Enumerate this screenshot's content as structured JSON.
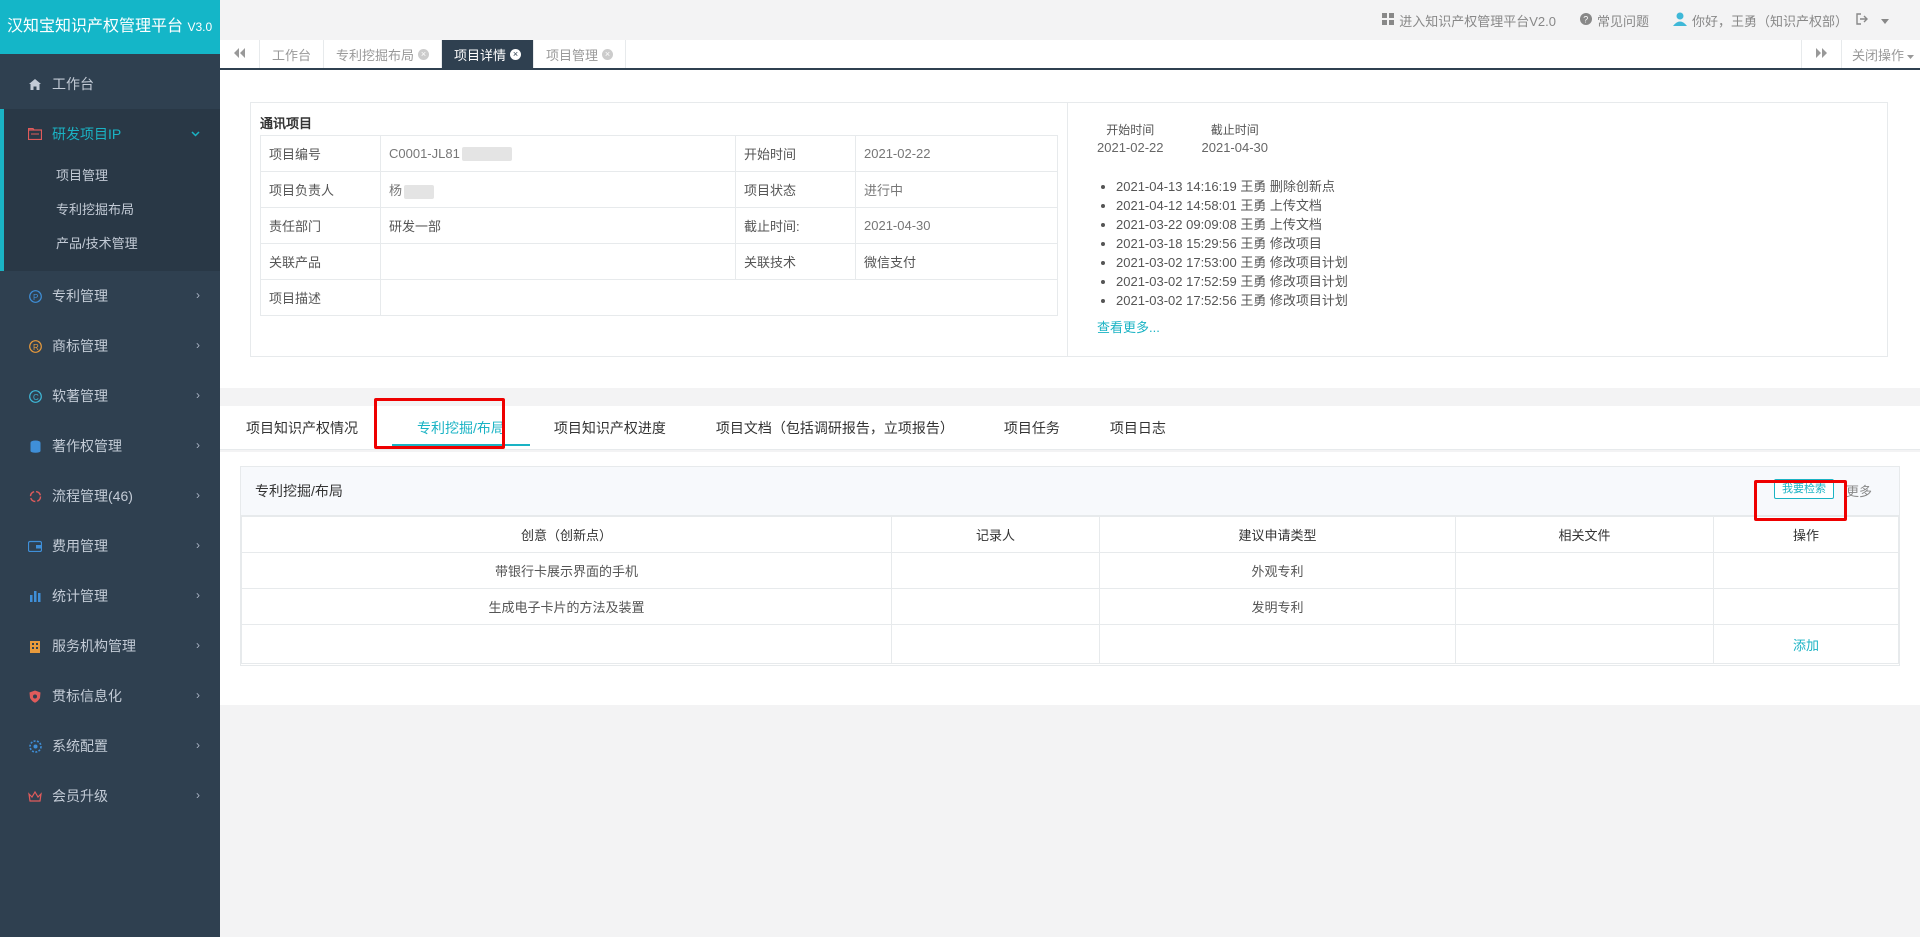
{
  "brand": {
    "title": "汉知宝知识产权管理平台",
    "version": "V3.0"
  },
  "sidebar": {
    "items": [
      {
        "label": "工作台"
      },
      {
        "label": "研发项目IP",
        "children": [
          "项目管理",
          "专利挖掘布局",
          "产品/技术管理"
        ]
      },
      {
        "label": "专利管理"
      },
      {
        "label": "商标管理"
      },
      {
        "label": "软著管理"
      },
      {
        "label": "著作权管理"
      },
      {
        "label": "流程管理(46)"
      },
      {
        "label": "费用管理"
      },
      {
        "label": "统计管理"
      },
      {
        "label": "服务机构管理"
      },
      {
        "label": "贯标信息化"
      },
      {
        "label": "系统配置"
      },
      {
        "label": "会员升级"
      }
    ]
  },
  "topbar": {
    "enter_v2": "进入知识产权管理平台V2.0",
    "faq": "常见问题",
    "user": "你好，王勇（知识产权部）"
  },
  "page_tabs": {
    "tabs": [
      "工作台",
      "专利挖掘布局",
      "项目详情",
      "项目管理"
    ],
    "active": "项目详情",
    "close_ops": "关闭操作"
  },
  "project": {
    "title": "通讯项目",
    "rows": [
      {
        "l1": "项目编号",
        "v1": "C0001-JL81",
        "l2": "开始时间",
        "v2": "2021-02-22"
      },
      {
        "l1": "项目负责人",
        "v1": "杨",
        "l2": "项目状态",
        "v2": "进行中"
      },
      {
        "l1": "责任部门",
        "v1": "研发一部",
        "l2": "截止时间:",
        "v2": "2021-04-30"
      },
      {
        "l1": "关联产品",
        "v1": "",
        "l2": "关联技术",
        "v2": "微信支付"
      }
    ],
    "desc_label": "项目描述",
    "desc_value": ""
  },
  "timeline": {
    "start_label": "开始时间",
    "start_value": "2021-02-22",
    "end_label": "截止时间",
    "end_value": "2021-04-30",
    "logs": [
      "2021-04-13 14:16:19 王勇 删除创新点",
      "2021-04-12 14:58:01 王勇 上传文档",
      "2021-03-22 09:09:08 王勇 上传文档",
      "2021-03-18 15:29:56 王勇 修改项目",
      "2021-03-02 17:53:00 王勇 修改项目计划",
      "2021-03-02 17:52:59 王勇 修改项目计划",
      "2021-03-02 17:52:56 王勇 修改项目计划"
    ],
    "more": "查看更多..."
  },
  "sub_tabs": {
    "tabs": [
      "项目知识产权情况",
      "专利挖掘/布局",
      "项目知识产权进度",
      "项目文档（包括调研报告，立项报告）",
      "项目任务",
      "项目日志"
    ],
    "active": "专利挖掘/布局"
  },
  "mining": {
    "title": "专利挖掘/布局",
    "search_button": "我要检索",
    "more_button": "更多",
    "columns": [
      "创意（创新点）",
      "记录人",
      "建议申请类型",
      "相关文件",
      "操作"
    ],
    "rows": [
      [
        "带银行卡展示界面的手机",
        "",
        "外观专利",
        "",
        ""
      ],
      [
        "生成电子卡片的方法及装置",
        "",
        "发明专利",
        "",
        ""
      ]
    ],
    "add_label": "添加"
  },
  "colors": {
    "accent": "#1ab3c4",
    "sidebar_bg": "#2f4050",
    "highlight": "#ee0000"
  }
}
